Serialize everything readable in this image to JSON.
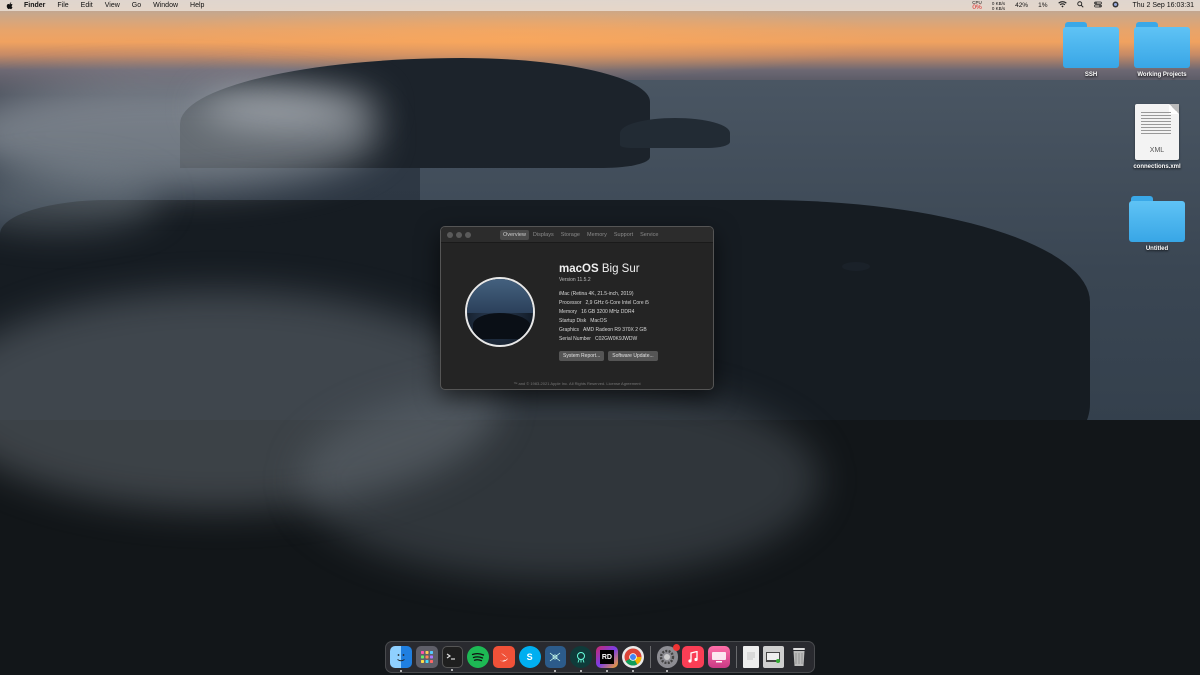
{
  "menubar": {
    "app_name": "Finder",
    "items": [
      "File",
      "Edit",
      "View",
      "Go",
      "Window",
      "Help"
    ],
    "status": {
      "cpu_label": "CPU",
      "cpu_value": "0%",
      "net_up": "0 KB/s",
      "net_down": "0 KB/s",
      "battery_value": "42%",
      "mem_value": "1%"
    },
    "clock": "Thu 2 Sep  16:03:31"
  },
  "desktop": {
    "icons": [
      {
        "label": "SSH",
        "type": "folder"
      },
      {
        "label": "Working Projects",
        "type": "folder"
      },
      {
        "label": "connections.xml",
        "type": "document",
        "tag": "XML"
      },
      {
        "label": "Untitled",
        "type": "folder"
      }
    ]
  },
  "about_window": {
    "tabs": [
      "Overview",
      "Displays",
      "Storage",
      "Memory",
      "Support",
      "Service"
    ],
    "active_tab": "Overview",
    "os_name_bold": "macOS",
    "os_name_light": "Big Sur",
    "version": "Version 11.5.2",
    "specs": [
      {
        "label": "iMac (Retina 4K, 21.5-inch, 2019)",
        "value": ""
      },
      {
        "label": "Processor",
        "value": "2,9 GHz 6-Core Intel Core i5"
      },
      {
        "label": "Memory",
        "value": "16 GB 3200 MHz DDR4"
      },
      {
        "label": "Startup Disk",
        "value": "MacOS"
      },
      {
        "label": "Graphics",
        "value": "AMD Radeon R9 370X 2 GB"
      },
      {
        "label": "Serial Number",
        "value": "C02GW0K9JWDW"
      }
    ],
    "buttons": {
      "system_report": "System Report...",
      "software_update": "Software Update..."
    },
    "footer": "™ and © 1983-2021 Apple Inc. All Rights Reserved. License Agreement"
  },
  "dock": {
    "apps": [
      {
        "name": "finder",
        "color": "#2b8fe8"
      },
      {
        "name": "launchpad",
        "color": "#6c6c74"
      },
      {
        "name": "terminal",
        "color": "#1f1f1f"
      },
      {
        "name": "spotify",
        "color": "#1db954"
      },
      {
        "name": "swift",
        "color": "#f05138"
      },
      {
        "name": "skype",
        "color": "#00aff0"
      },
      {
        "name": "mysql-workbench",
        "color": "#2c5b8a"
      },
      {
        "name": "gitkraken",
        "color": "#0f3b3a"
      },
      {
        "name": "rider",
        "color": "#c9286a"
      },
      {
        "name": "chrome",
        "color": "#e9e9e9"
      },
      {
        "name": "system-preferences",
        "color": "#8d8d93"
      },
      {
        "name": "music",
        "color": "#fa3e55"
      },
      {
        "name": "cleanmymac",
        "color": "#e34794"
      },
      {
        "name": "document",
        "color": "#eeeeee"
      },
      {
        "name": "preview",
        "color": "#cfcfcf"
      },
      {
        "name": "trash",
        "color": "#bcbcbc"
      }
    ]
  }
}
